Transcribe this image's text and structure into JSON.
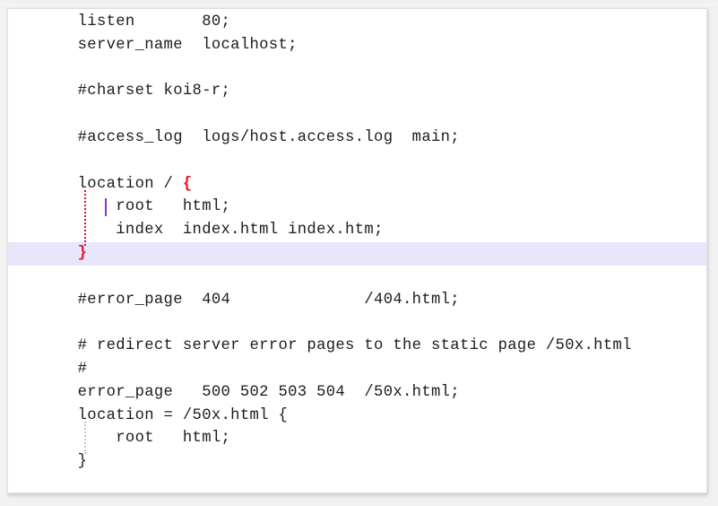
{
  "editor": {
    "language": "nginx",
    "font_family_style": "monospace-serif",
    "colors": {
      "background": "#ffffff",
      "page_background": "#f2f2f2",
      "text": "#1c1c1c",
      "current_line_highlight": "#e8e6fb",
      "brace_match": "#e8112d",
      "caret": "#8a2be2",
      "indent_guide_active": "#e8112d",
      "indent_guide_inactive": "#c9c9c9",
      "panel_border": "#e3e3e3"
    },
    "caret": {
      "line": 9,
      "column": 6
    },
    "current_line": 9,
    "lines": [
      {
        "n": 1,
        "segments": [
          {
            "text": "    listen       80;",
            "style": "plain"
          }
        ]
      },
      {
        "n": 2,
        "segments": [
          {
            "text": "    server_name  localhost;",
            "style": "plain"
          }
        ]
      },
      {
        "n": 3,
        "segments": [
          {
            "text": "",
            "style": "plain"
          }
        ]
      },
      {
        "n": 4,
        "segments": [
          {
            "text": "    #charset koi8-r;",
            "style": "plain"
          }
        ]
      },
      {
        "n": 5,
        "segments": [
          {
            "text": "",
            "style": "plain"
          }
        ]
      },
      {
        "n": 6,
        "segments": [
          {
            "text": "    #access_log  logs/host.access.log  main;",
            "style": "plain"
          }
        ]
      },
      {
        "n": 7,
        "segments": [
          {
            "text": "",
            "style": "plain"
          }
        ]
      },
      {
        "n": 8,
        "segments": [
          {
            "text": "    location / ",
            "style": "plain"
          },
          {
            "text": "{",
            "style": "brace-match"
          }
        ]
      },
      {
        "n": 9,
        "segments": [
          {
            "text": "        root   html;",
            "style": "plain"
          }
        ]
      },
      {
        "n": 10,
        "segments": [
          {
            "text": "        index  index.html index.htm;",
            "style": "plain"
          }
        ]
      },
      {
        "n": 11,
        "current": true,
        "segments": [
          {
            "text": "    ",
            "style": "plain"
          },
          {
            "text": "}",
            "style": "brace-match"
          }
        ]
      },
      {
        "n": 12,
        "segments": [
          {
            "text": "",
            "style": "plain"
          }
        ]
      },
      {
        "n": 13,
        "segments": [
          {
            "text": "    #error_page  404              /404.html;",
            "style": "plain"
          }
        ]
      },
      {
        "n": 14,
        "segments": [
          {
            "text": "",
            "style": "plain"
          }
        ]
      },
      {
        "n": 15,
        "segments": [
          {
            "text": "    # redirect server error pages to the static page /50x.html",
            "style": "plain"
          }
        ]
      },
      {
        "n": 16,
        "segments": [
          {
            "text": "    #",
            "style": "plain"
          }
        ]
      },
      {
        "n": 17,
        "segments": [
          {
            "text": "    error_page   500 502 503 504  /50x.html;",
            "style": "plain"
          }
        ]
      },
      {
        "n": 18,
        "segments": [
          {
            "text": "    location = /50x.html {",
            "style": "plain"
          }
        ]
      },
      {
        "n": 19,
        "segments": [
          {
            "text": "        root   html;",
            "style": "plain"
          }
        ]
      },
      {
        "n": 20,
        "segments": [
          {
            "text": "    }",
            "style": "plain"
          }
        ]
      }
    ],
    "indent_guides": [
      {
        "id": "guide-location-block",
        "state": "active",
        "line_start": 9,
        "line_end": 11
      },
      {
        "id": "guide-50x-block",
        "state": "inactive",
        "line_start": 19,
        "line_end": 20
      }
    ]
  }
}
